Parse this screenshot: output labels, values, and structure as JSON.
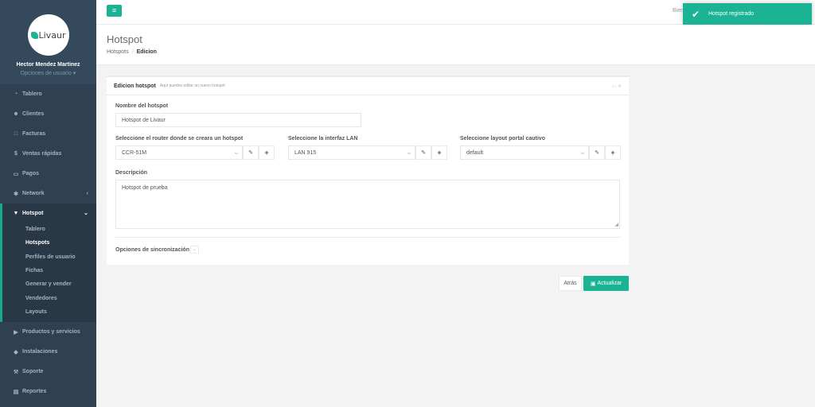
{
  "sidebar": {
    "logo_text": "Livaur",
    "user_name": "Hector Mendez Martinez",
    "user_options": "Opciones de usuario ▾",
    "items_top": [
      {
        "label": "Tablero",
        "icon": "dashboard-icon",
        "glyph": "◔"
      },
      {
        "label": "Clientes",
        "icon": "users-icon",
        "glyph": "☻"
      },
      {
        "label": "Facturas",
        "icon": "file-icon",
        "glyph": "□"
      },
      {
        "label": "Ventas rápidas",
        "icon": "dollar-icon",
        "glyph": "$"
      },
      {
        "label": "Pagos",
        "icon": "money-icon",
        "glyph": "▭"
      },
      {
        "label": "Network",
        "icon": "network-icon",
        "glyph": "✱",
        "chevron": "‹"
      }
    ],
    "active": {
      "label": "Hotspot",
      "icon": "wifi-icon",
      "glyph": "▼",
      "chevron": "⌄"
    },
    "sub_items": [
      "Tablero",
      "Hotspots",
      "Perfiles de usuario",
      "Fichas",
      "Generar y vender",
      "Vendedores",
      "Layouts"
    ],
    "selected_sub": "Hotspots",
    "items_bottom": [
      {
        "label": "Productos y servicios",
        "icon": "tag-icon",
        "glyph": "▶"
      },
      {
        "label": "Instalaciones",
        "icon": "diamond-icon",
        "glyph": "◆"
      },
      {
        "label": "Soporte",
        "icon": "wrench-icon",
        "glyph": "⚒"
      },
      {
        "label": "Reportes",
        "icon": "report-icon",
        "glyph": "▤"
      }
    ]
  },
  "topbar": {
    "menu_glyph": "≡",
    "welcome": "Bien"
  },
  "toast": {
    "message": "Hotspot registrado"
  },
  "header": {
    "title": "Hotspot",
    "breadcrumb": [
      "Hotspots",
      "Edicion"
    ]
  },
  "panel": {
    "title": "Edicion hotspot",
    "subtitle": "Aquí puedes editar un nuevo hotspot",
    "name_label": "Nombre del hotspot",
    "name_value": "Hotspot de Livaur",
    "router_label": "Seleccione el router donde se creara un hotspot",
    "router_value": "CCR-51M",
    "lan_label": "Seleccione la interfaz LAN",
    "lan_value": "LAN 915",
    "layout_label": "Seleccione layout portal cautivo",
    "layout_value": "default",
    "desc_label": "Descripción",
    "desc_value": "Hotspot de prueba",
    "sync_label": "Opciones de sincronización"
  },
  "actions": {
    "back": "Atrás",
    "save": "Actualizar"
  },
  "colors": {
    "accent": "#1ab394",
    "sidebar": "#2f4050"
  }
}
